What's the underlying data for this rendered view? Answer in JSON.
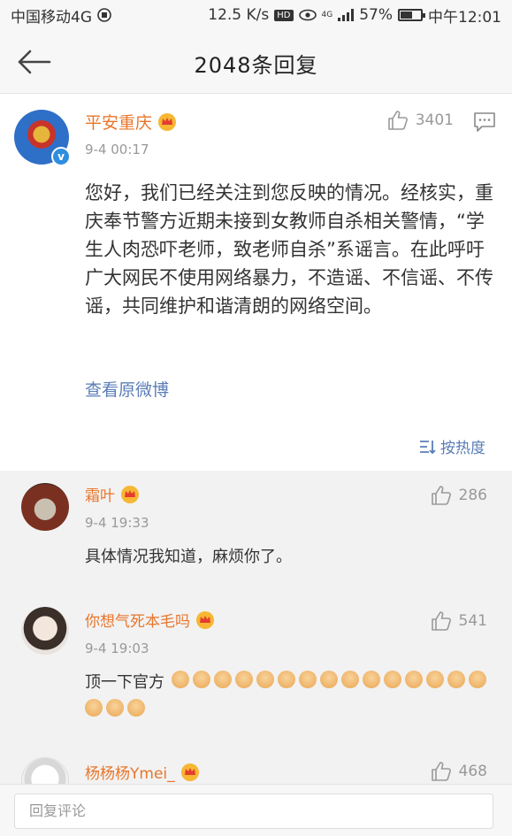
{
  "status_bar": {
    "carrier": "中国移动4G",
    "speed": "12.5 K/s",
    "hd": "HD",
    "network": "4G",
    "battery_percent": "57%",
    "battery_level": 0.57,
    "time": "中午12:01"
  },
  "nav": {
    "title": "2048条回复"
  },
  "main_post": {
    "author": "平安重庆",
    "time": "9-4 00:17",
    "likes": "3401",
    "text": "您好，我们已经关注到您反映的情况。经核实，重庆奉节警方近期未接到女教师自杀相关警情，“学生人肉恐吓老师，致老师自杀”系谣言。在此呼吁广大网民不使用网络暴力，不造谣、不信谣、不传谣，共同维护和谐清朗的网络空间。",
    "view_original": "查看原微博",
    "verified_badge": "v"
  },
  "sort": {
    "label": "按热度"
  },
  "replies": [
    {
      "author": "霜叶",
      "time": "9-4 19:33",
      "likes": "286",
      "text": "具体情况我知道，麻烦你了。"
    },
    {
      "author": "你想气死本毛吗",
      "time": "9-4 19:03",
      "likes": "541",
      "text": "顶一下官方",
      "emoji_count": 18
    },
    {
      "author": "杨杨杨Ymei_",
      "time": "",
      "likes": "468",
      "text": ""
    }
  ],
  "input": {
    "placeholder": "回复评论"
  },
  "colors": {
    "accent_name": "#e8762b",
    "link": "#5b7db7",
    "verified": "#2e8ee0"
  }
}
